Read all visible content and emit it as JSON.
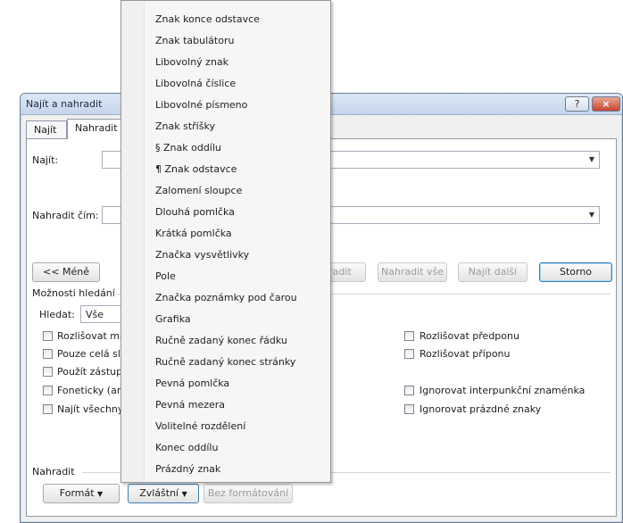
{
  "dialog": {
    "title": "Najít a nahradit",
    "help": "?",
    "close": "×",
    "tabs": [
      "Najít",
      "Nahradit"
    ],
    "find_label": "Najít:",
    "replace_label": "Nahradit čím:",
    "less_button": "<< Méně",
    "replace_button": "Nahradit",
    "replace_all_button": "Nahradit vše",
    "find_next_button": "Najít další",
    "cancel_button": "Storno",
    "search_options_label": "Možnosti hledání",
    "search_label": "Hledat:",
    "search_value": "Vše",
    "left_options": [
      "Rozlišovat malá a velká",
      "Pouze celá slova",
      "Použít zástupné znaky",
      "Foneticky (angličtina)",
      "Najít všechny tvary slova"
    ],
    "right_options": [
      "Rozlišovat předponu",
      "Rozlišovat příponu",
      "Ignorovat interpunkční znaménka",
      "Ignorovat prázdné znaky"
    ],
    "replace_section_label": "Nahradit",
    "format_button": "Formát",
    "special_button": "Zvláštní",
    "no_format_button": "Bez formátování"
  },
  "menu": {
    "items": [
      "Znak konce odstavce",
      "Znak tabulátoru",
      "Libovolný znak",
      "Libovolná číslice",
      "Libovolné písmeno",
      "Znak stříšky",
      "§ Znak oddílu",
      "¶ Znak odstavce",
      "Zalomení sloupce",
      "Dlouhá pomlčka",
      "Krátká pomlčka",
      "Značka vysvětlivky",
      "Pole",
      "Značka poznámky pod čarou",
      "Grafika",
      "Ručně zadaný konec řádku",
      "Ručně zadaný konec stránky",
      "Pevná pomlčka",
      "Pevná mezera",
      "Volitelné rozdělení",
      "Konec oddílu",
      "Prázdný znak"
    ]
  }
}
